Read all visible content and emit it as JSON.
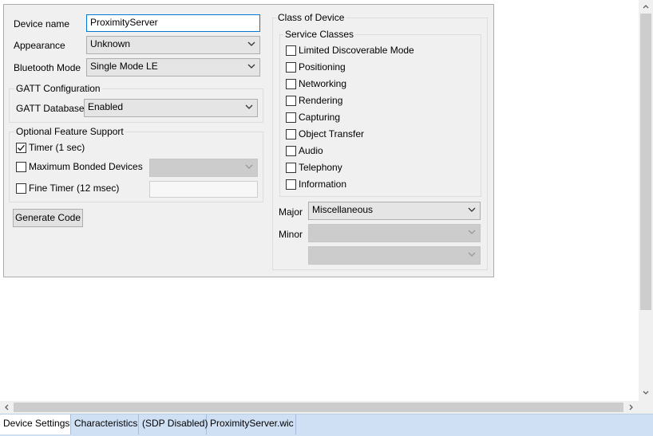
{
  "device": {
    "name_label": "Device name",
    "name_value": "ProximityServer",
    "appearance_label": "Appearance",
    "appearance_value": "Unknown",
    "bt_mode_label": "Bluetooth Mode",
    "bt_mode_value": "Single Mode LE"
  },
  "gatt": {
    "title": "GATT Configuration",
    "db_label": "GATT Database",
    "db_value": "Enabled"
  },
  "optional": {
    "title": "Optional Feature Support",
    "timer_label": "Timer (1 sec)",
    "timer_checked": true,
    "bonded_label": "Maximum Bonded Devices",
    "bonded_checked": false,
    "bonded_value": "",
    "fine_label": "Fine Timer (12 msec)",
    "fine_checked": false,
    "fine_value": ""
  },
  "generate_label": "Generate Code",
  "cod": {
    "title": "Class of Device",
    "service_title": "Service Classes",
    "services": [
      "Limited Discoverable Mode",
      "Positioning",
      "Networking",
      "Rendering",
      "Capturing",
      "Object Transfer",
      "Audio",
      "Telephony",
      "Information"
    ],
    "major_label": "Major",
    "major_value": "Miscellaneous",
    "minor_label": "Minor",
    "minor_value": "",
    "minor2_value": ""
  },
  "tabs": [
    {
      "label": "Device Settings",
      "active": true
    },
    {
      "label": "Characteristics",
      "active": false
    },
    {
      "label": "(SDP Disabled)",
      "active": false
    },
    {
      "label": "ProximityServer.wic",
      "active": false
    }
  ],
  "colors": {
    "panel_bg": "#f0f0f0",
    "tabbar_bg": "#cfe0f4",
    "focus_border": "#0078d7"
  },
  "icons": {
    "dropdown": "chevron-down-icon",
    "check": "checkmark-icon",
    "scroll_up": "arrow-up-icon",
    "scroll_down": "arrow-down-icon",
    "scroll_left": "arrow-left-icon",
    "scroll_right": "arrow-right-icon"
  }
}
